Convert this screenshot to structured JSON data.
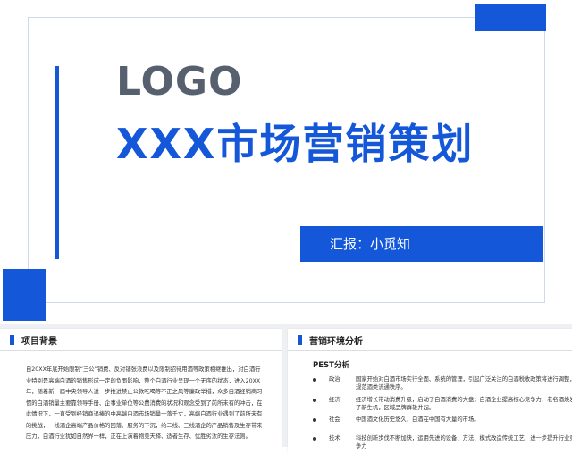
{
  "slide": {
    "logo": "LOGO",
    "title": "XXX市场营销策划",
    "reporter": "汇报：小觅知"
  },
  "left_panel": {
    "heading": "项目背景",
    "paragraph": "自20XX年底开始限制“三公”销费、反对铺张浪费以及限制招待用酒等政策相继推出，对白酒行业特别是高端白酒的销售形成一定的负面影响，整个白酒行业呈现一个无序的状态，进入20XX年，随着新一届中央领导人进一步推进禁止公款吃喝等不正之风等廉政举措，众多白酒经销商习惯的白酒销量主要靠领导手册、企事业单位等公费消费的状况和观念受到了前所未有的冲击，在此情况下，一直受到经销商追捧的中高端白酒市场销量一落千丈，高端白酒行业遇到了前所未有的挑战，一线酒企高端产品价格的回落、服务的下沉，给二线、三线酒企的产品销售及生存带来压力，白酒行业犹如自然界一样，正在上演着物竞天择、适者生存、优胜劣汰的生存法则。"
  },
  "right_panel": {
    "heading": "营销环境分析",
    "pest_title": "PEST分析",
    "items": [
      {
        "key": "政治",
        "desc": "国家开始对白酒市场实行全面、系统的管理，引起广泛关注的白酒税收政策将进行调整，规范酒类流通秩序。"
      },
      {
        "key": "经济",
        "desc": "经济增长带动消费升级，启动了白酒消费的大盘；白酒企业提高核心竞争力，老名酒焕发了新生机，区域品牌群雄并起。"
      },
      {
        "key": "社会",
        "desc": "中国酒文化历史悠久，白酒在中国有大量的市场。"
      },
      {
        "key": "技术",
        "desc": "科技创新步伐不断加快，运用先进的设备、方法、模式改造传统工艺，进一步提升行业竞争力"
      }
    ]
  },
  "colors": {
    "accent": "#1457d9",
    "logo_gray": "#56606e"
  }
}
